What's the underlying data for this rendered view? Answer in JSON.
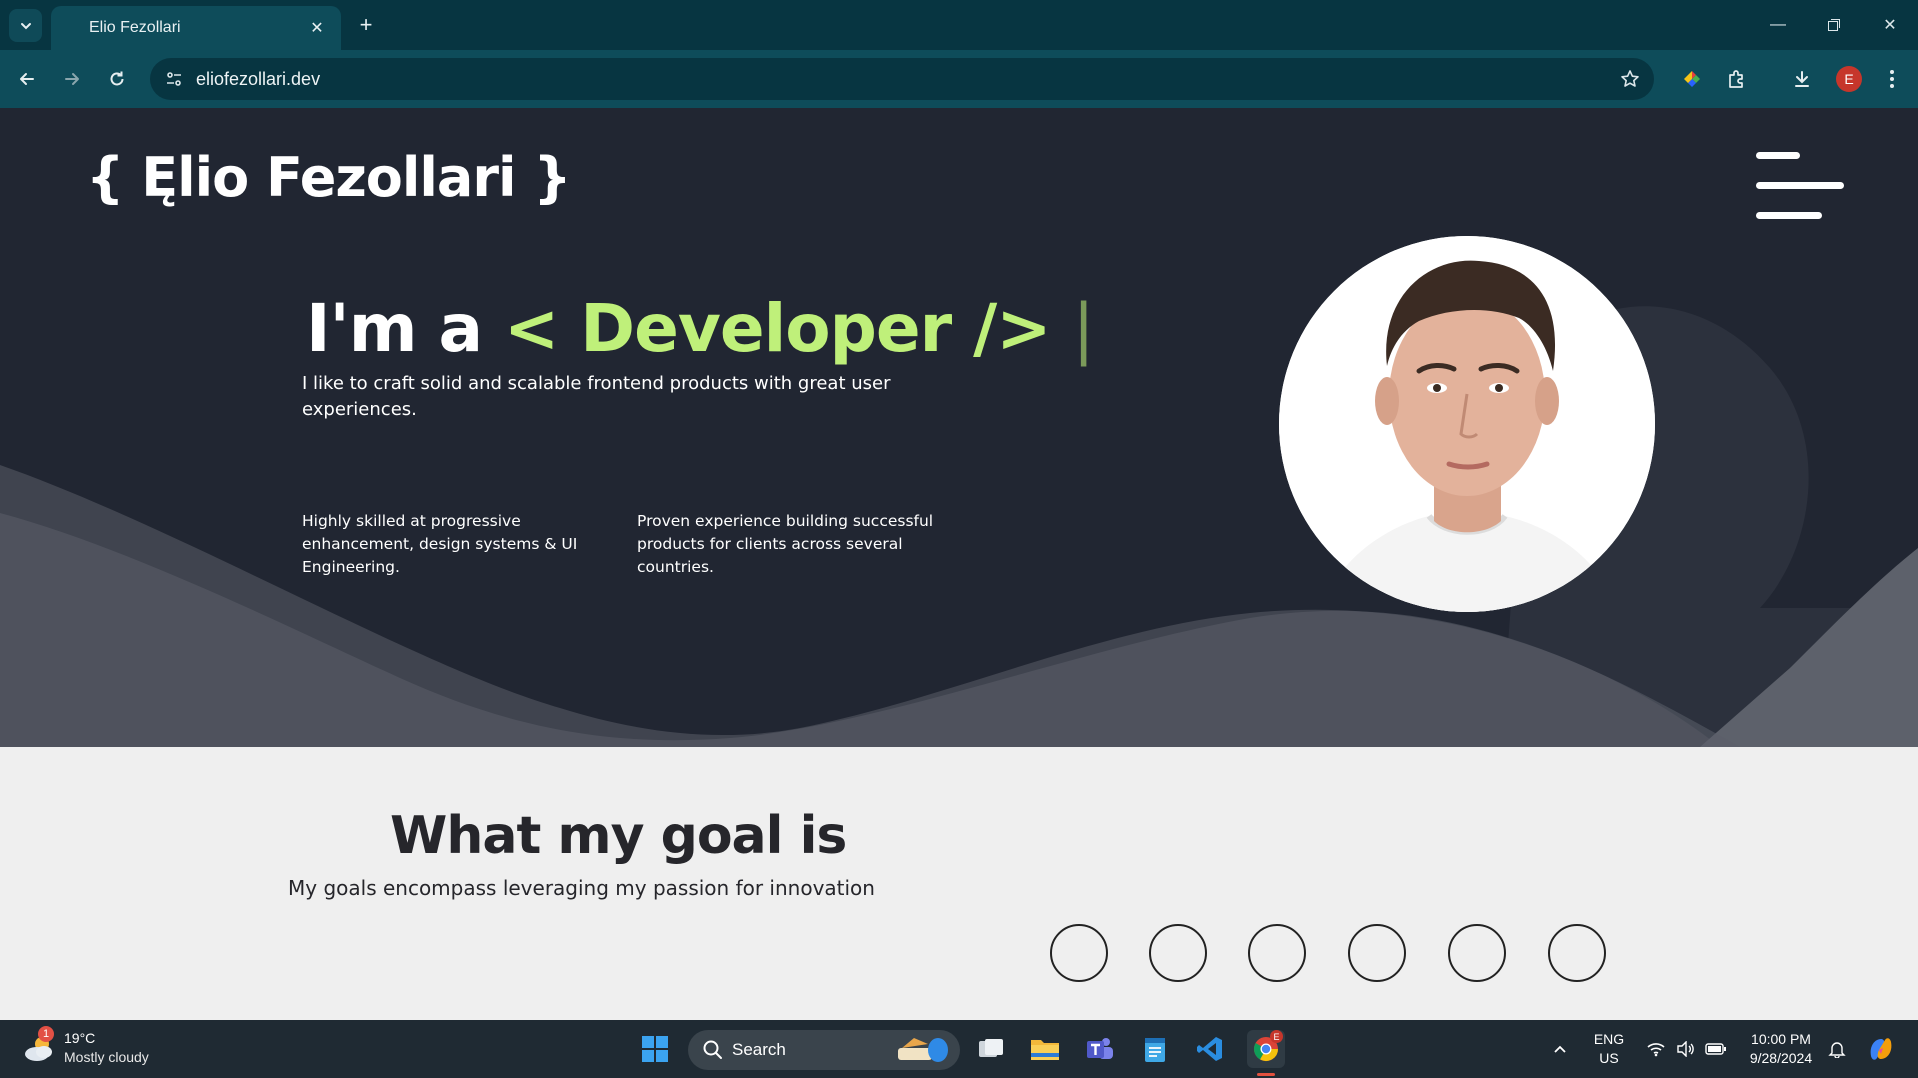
{
  "browser": {
    "tab_title": "Elio Fezollari",
    "url": "eliofezollari.dev",
    "profile_initial": "E"
  },
  "site": {
    "logo_text": "{ Ęlio Fezollari }",
    "headline_prefix": "I'm a ",
    "headline_accent": "< Developer />",
    "headline_cursor": "|",
    "subtitle": "I like to craft solid and scalable frontend products with great user experiences.",
    "features": [
      "Highly skilled at progressive enhancement, design systems & UI Engineering.",
      "Proven experience building successful products for clients across several countries."
    ],
    "goal_title": "What my goal is",
    "goal_subtitle": "My goals encompass leveraging my passion for innovation",
    "carousel_dots": 6,
    "colors": {
      "hero_bg": "#212632",
      "accent": "#bff07a",
      "page_bg": "#efefef"
    }
  },
  "taskbar": {
    "weather_temp": "19°C",
    "weather_desc": "Mostly cloudy",
    "weather_badge": "1",
    "search_label": "Search",
    "lang_primary": "ENG",
    "lang_secondary": "US",
    "time": "10:00 PM",
    "date": "9/28/2024"
  }
}
